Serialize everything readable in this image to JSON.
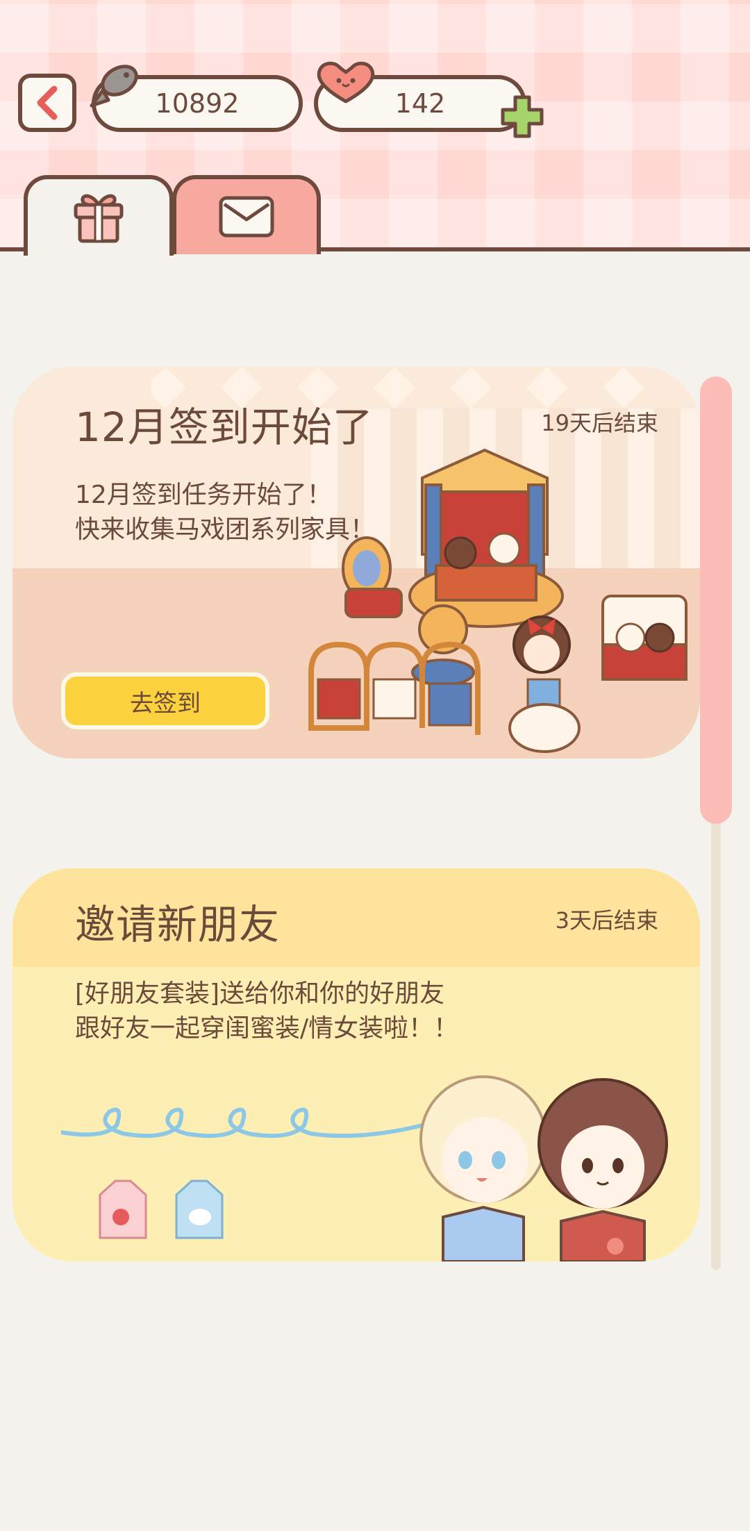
{
  "header": {
    "fish_count": "10892",
    "heart_count": "142"
  },
  "tabs": [
    {
      "name": "gift",
      "icon": "gift-icon",
      "active": true
    },
    {
      "name": "mail",
      "icon": "mail-icon",
      "active": false
    }
  ],
  "cards": [
    {
      "title": "12月签到开始了",
      "ends": "19天后结束",
      "desc_line1": "12月签到任务开始了！",
      "desc_line2": "快来收集马戏团系列家具！",
      "button": "去签到"
    },
    {
      "title": "邀请新朋友",
      "ends": "3天后结束",
      "desc_line1": "[好朋友套装]送给你和你的好朋友",
      "desc_line2": "跟好友一起穿闺蜜装/情女装啦！！"
    }
  ],
  "colors": {
    "brown": "#6e4a3e",
    "pink_header": "#ffd7d3",
    "yellow_button": "#fbd13d",
    "scroll_thumb": "#fbbdb5"
  }
}
